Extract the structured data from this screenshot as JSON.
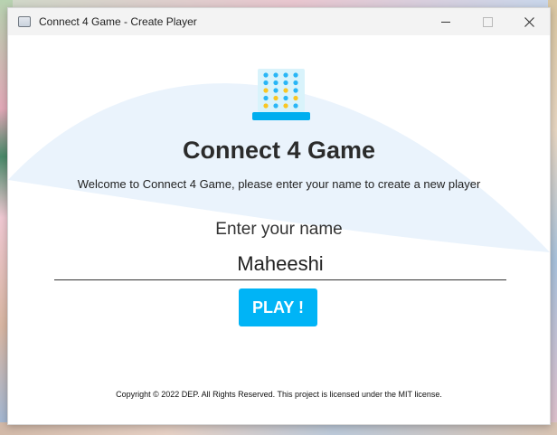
{
  "window": {
    "title": "Connect 4 Game - Create Player",
    "app_icon": "app-window-icon",
    "controls": {
      "minimize_icon": "minimize-icon",
      "maximize_icon": "maximize-icon",
      "close_icon": "close-icon"
    }
  },
  "main": {
    "logo_icon": "connect-four-board-icon",
    "title": "Connect 4 Game",
    "welcome": "Welcome to Connect 4 Game, please enter your name to create a new player",
    "name_label": "Enter your name",
    "name_input_value": "Maheeshi",
    "play_label": "PLAY !",
    "footer": "Copyright © 2022 DEP. All Rights Reserved. This project is licensed under the MIT license."
  },
  "colors": {
    "accent": "#00b4f6",
    "arc": "#eaf3fc",
    "logo_board": "#d9f3fb",
    "logo_base": "#00aeef",
    "token_blue": "#29b6f6",
    "token_yellow": "#f9c623"
  }
}
